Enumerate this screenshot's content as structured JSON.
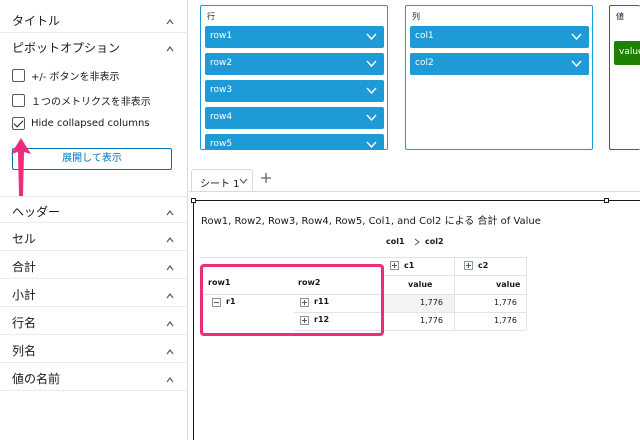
{
  "left_panel": {
    "sections_top": [
      {
        "label": "タイトル"
      },
      {
        "label": "ピボットオプション"
      }
    ],
    "pivot_options": [
      {
        "label": "+/- ボタンを非表示",
        "checked": false
      },
      {
        "label": "１つのメトリクスを非表示",
        "checked": false
      },
      {
        "label": "Hide collapsed columns",
        "checked": true
      }
    ],
    "expand_button": "展開して表示",
    "sections_bottom": [
      {
        "label": "ヘッダー"
      },
      {
        "label": "セル"
      },
      {
        "label": "合計"
      },
      {
        "label": "小計"
      },
      {
        "label": "行名"
      },
      {
        "label": "列名"
      },
      {
        "label": "値の名前"
      }
    ]
  },
  "field_wells": {
    "rows": {
      "label": "行",
      "fields": [
        "row1",
        "row2",
        "row3",
        "row4",
        "row5"
      ]
    },
    "columns": {
      "label": "列",
      "fields": [
        "col1",
        "col2"
      ]
    },
    "values": {
      "label": "値",
      "fields": [
        "value"
      ]
    }
  },
  "tabs": {
    "sheet_label": "シート 1"
  },
  "visual": {
    "title": "Row1, Row2, Row3, Row4, Row5, Col1, and Col2 による 合計 of Value",
    "column_path": [
      "col1",
      "col2"
    ],
    "table": {
      "col_headers": [
        "c1",
        "c2"
      ],
      "row_headers": [
        "row1",
        "row2"
      ],
      "value_header": "value",
      "rows": [
        {
          "row1": "r1",
          "row2": "r11",
          "values": [
            "1,776",
            "1,776"
          ]
        },
        {
          "row1": "",
          "row2": "r12",
          "values": [
            "1,776",
            "1,776"
          ]
        }
      ]
    }
  },
  "colors": {
    "well_blue": "#1e9ad6",
    "values_green": "#1d8102",
    "highlight_pink": "#ef2b7c",
    "link_blue": "#0073bb"
  }
}
